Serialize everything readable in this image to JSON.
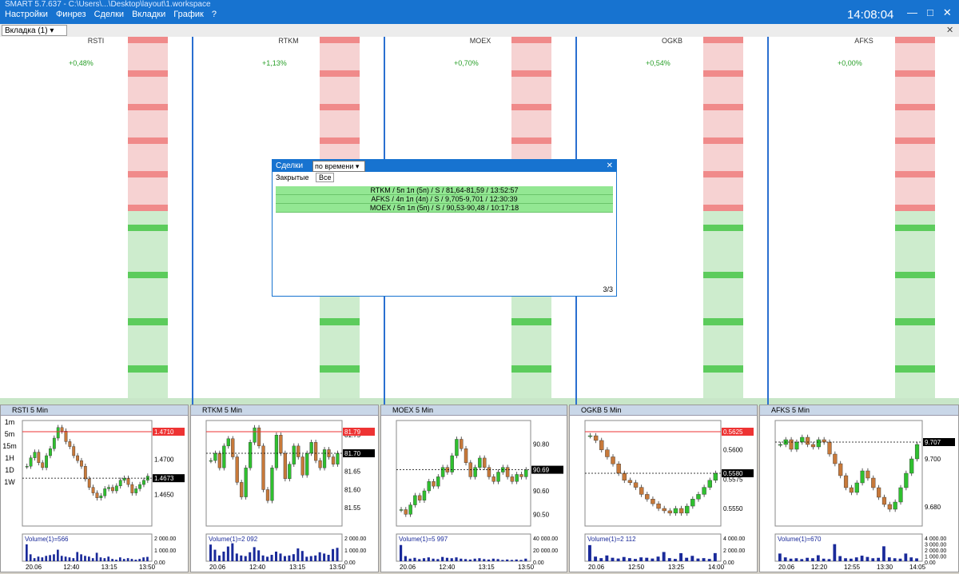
{
  "window": {
    "path": "SMART 5.7.637 - C:\\Users\\...\\Desktop\\layout\\1.workspace",
    "menu": [
      "Настройки",
      "Финрез",
      "Сделки",
      "Вкладки",
      "График",
      "?"
    ],
    "clock": "14:08:04",
    "tab": "Вкладка (1)"
  },
  "doms": [
    {
      "ticker": "RSTI",
      "pct": "+0,48%"
    },
    {
      "ticker": "RTKM",
      "pct": "+1,13%"
    },
    {
      "ticker": "MOEX",
      "pct": "+0,70%"
    },
    {
      "ticker": "OGKB",
      "pct": "+0,54%"
    },
    {
      "ticker": "AFKS",
      "pct": "+0,00%"
    }
  ],
  "dialog": {
    "title": "Сделки",
    "select": "по времени",
    "tab_closed": "Закрытые",
    "tab_all": "Все",
    "rows": [
      "RTKM / 5п 1п (5п) / S / 81,64-81,59 / 13:52:57",
      "AFKS / 4п 1п (4п) / S / 9,705-9,701 / 12:30:39",
      "MOEX / 5п 1п (5п) / S / 90,53-90,48 / 10:17:18"
    ],
    "count": "3/3"
  },
  "timeframes": [
    "1m",
    "5m",
    "15m",
    "1H",
    "1D",
    "1W"
  ],
  "chart_data": [
    {
      "type": "candlestick",
      "title": "RSTI 5 Min",
      "yticks": [
        1.47,
        1.465
      ],
      "ytick_labels": [
        "1.4700",
        "1.4650"
      ],
      "ylim": [
        1.4605,
        1.4755
      ],
      "last": 1.4673,
      "last_label": "1.4673",
      "top_label": "1.4710",
      "xticks": [
        "20.06",
        "12:40",
        "13:15",
        "13:50"
      ],
      "volume_label": "Volume(1)=566",
      "volume_ticks": [
        "2 000.00",
        "1 000.00",
        "0.00"
      ],
      "volume_max": 2500,
      "close": [
        1.469,
        1.4702,
        1.471,
        1.4695,
        1.4688,
        1.4705,
        1.4715,
        1.473,
        1.4745,
        1.474,
        1.4725,
        1.4718,
        1.4705,
        1.4698,
        1.469,
        1.4672,
        1.466,
        1.4652,
        1.4645,
        1.4648,
        1.4658,
        1.466,
        1.4655,
        1.4662,
        1.467,
        1.4673,
        1.4664,
        1.4652,
        1.4658,
        1.4664,
        1.467,
        1.4676
      ],
      "volume": [
        2200,
        900,
        400,
        600,
        500,
        700,
        800,
        900,
        1500,
        700,
        600,
        500,
        400,
        1200,
        900,
        700,
        600,
        400,
        1100,
        500,
        400,
        600,
        300,
        200,
        500,
        300,
        400,
        300,
        200,
        300,
        500,
        566
      ]
    },
    {
      "type": "candlestick",
      "title": "RTKM 5 Min",
      "yticks": [
        81.75,
        81.7,
        81.65,
        81.6,
        81.55
      ],
      "ytick_labels": [
        "81.75",
        "81.70",
        "81.65",
        "81.60",
        "81.55"
      ],
      "ylim": [
        81.5,
        81.79
      ],
      "last": 81.7,
      "last_label": "81.70",
      "top_label": "81.79",
      "xticks": [
        "20.06",
        "12:40",
        "13:15",
        "13:50"
      ],
      "volume_label": "Volume(1)=2 092",
      "volume_ticks": [
        "2 000.00",
        "1 000.00",
        "0.00"
      ],
      "volume_max": 3000,
      "close": [
        81.68,
        81.7,
        81.66,
        81.72,
        81.74,
        81.69,
        81.62,
        81.58,
        81.66,
        81.73,
        81.77,
        81.72,
        81.6,
        81.57,
        81.66,
        81.75,
        81.7,
        81.63,
        81.67,
        81.72,
        81.69,
        81.64,
        81.7,
        81.73,
        81.68,
        81.66,
        81.71,
        81.69,
        81.67,
        81.7
      ],
      "volume": [
        2600,
        1800,
        900,
        1500,
        2300,
        2800,
        1200,
        900,
        800,
        1400,
        2200,
        1700,
        900,
        700,
        1000,
        1500,
        1200,
        800,
        900,
        1100,
        2000,
        1600,
        700,
        800,
        900,
        1400,
        1200,
        1000,
        1900,
        2092
      ]
    },
    {
      "type": "candlestick",
      "title": "MOEX 5 Min",
      "yticks": [
        90.8,
        90.6,
        90.5
      ],
      "ytick_labels": [
        "90.80",
        "90.60",
        "90.50"
      ],
      "ylim": [
        90.45,
        90.9
      ],
      "last": 90.69,
      "last_label": "90.69",
      "top_label": "",
      "xticks": [
        "20.06",
        "12:40",
        "13:15",
        "13:50"
      ],
      "volume_label": "Volume(1)=5 997",
      "volume_ticks": [
        "40 000.00",
        "20 000.00",
        "0.00"
      ],
      "volume_max": 45000,
      "close": [
        90.52,
        90.5,
        90.54,
        90.58,
        90.56,
        90.6,
        90.64,
        90.62,
        90.66,
        90.7,
        90.68,
        90.75,
        90.82,
        90.78,
        90.72,
        90.66,
        90.7,
        90.74,
        90.7,
        90.66,
        90.64,
        90.68,
        90.7,
        90.66,
        90.64,
        90.67,
        90.66,
        90.69
      ],
      "volume": [
        38000,
        12000,
        6000,
        8000,
        5000,
        7000,
        9000,
        6000,
        5000,
        10000,
        8000,
        7000,
        9000,
        6000,
        5000,
        4000,
        6000,
        7000,
        5000,
        4000,
        6000,
        5000,
        3000,
        4000,
        3000,
        4000,
        3000,
        5997
      ]
    },
    {
      "type": "candlestick",
      "title": "OGKB 5 Min",
      "yticks": [
        0.56,
        0.5575,
        0.555
      ],
      "ytick_labels": [
        "0.5600",
        "0.5575",
        "0.5550"
      ],
      "ylim": [
        0.5535,
        0.5625
      ],
      "last": 0.558,
      "last_label": "0.5580",
      "top_label": "0.5625",
      "xticks": [
        "20.06",
        "12:50",
        "13:25",
        "14:00"
      ],
      "volume_label": "Volume(1)=2 112",
      "volume_ticks": [
        "4 000.00",
        "2 000.00",
        "0.00"
      ],
      "volume_max": 5000,
      "close": [
        0.5612,
        0.5608,
        0.56,
        0.5594,
        0.5588,
        0.558,
        0.5574,
        0.5572,
        0.5568,
        0.5562,
        0.5558,
        0.5554,
        0.555,
        0.5548,
        0.5546,
        0.555,
        0.5546,
        0.5552,
        0.5558,
        0.5562,
        0.5568,
        0.5574,
        0.558
      ],
      "volume": [
        4200,
        1200,
        800,
        1500,
        900,
        700,
        1100,
        800,
        600,
        1000,
        900,
        700,
        1200,
        2400,
        800,
        600,
        2100,
        900,
        1400,
        700,
        800,
        600,
        2112
      ]
    },
    {
      "type": "candlestick",
      "title": "AFKS 5 Min",
      "yticks": [
        9.7,
        9.68
      ],
      "ytick_labels": [
        "9.700",
        "9.680"
      ],
      "ylim": [
        9.672,
        9.716
      ],
      "last": 9.707,
      "last_label": "9.707",
      "top_label": "",
      "xticks": [
        "20.06",
        "12:20",
        "12:55",
        "13:30",
        "14:05"
      ],
      "volume_label": "Volume(1)=670",
      "volume_ticks": [
        "4 000.00",
        "3 000.00",
        "2 000.00",
        "1 000.00",
        "0.00"
      ],
      "volume_max": 4500,
      "close": [
        9.706,
        9.708,
        9.704,
        9.707,
        9.709,
        9.706,
        9.705,
        9.708,
        9.707,
        9.702,
        9.698,
        9.693,
        9.688,
        9.686,
        9.69,
        9.695,
        9.692,
        9.688,
        9.684,
        9.681,
        9.679,
        9.682,
        9.688,
        9.694,
        9.7,
        9.706
      ],
      "volume": [
        1800,
        900,
        600,
        700,
        500,
        800,
        700,
        1400,
        600,
        500,
        4000,
        1200,
        700,
        600,
        900,
        1300,
        1000,
        700,
        800,
        3500,
        900,
        700,
        600,
        1800,
        900,
        670
      ]
    }
  ]
}
